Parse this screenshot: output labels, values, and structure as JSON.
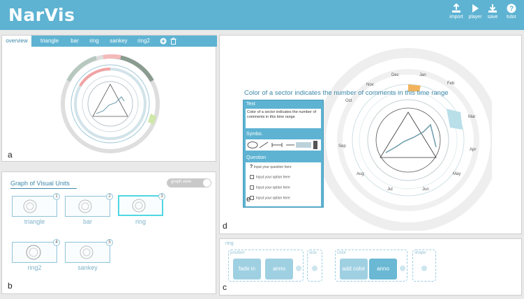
{
  "app": {
    "title": "NarVis"
  },
  "toolbar": {
    "import": "import",
    "player": "player",
    "save": "save",
    "tutor": "tutor"
  },
  "overview_tabs": [
    "overview",
    "triangle",
    "bar",
    "ring",
    "sankey",
    "ring2"
  ],
  "panel_labels": {
    "a": "a",
    "b": "b",
    "c": "c",
    "d": "d",
    "e": "e"
  },
  "graph": {
    "title": "Graph of Visual Units",
    "toggle": "graph view",
    "units": [
      {
        "num": "1",
        "label": "triangle"
      },
      {
        "num": "2",
        "label": "bar"
      },
      {
        "num": "3",
        "label": "ring"
      },
      {
        "num": "4",
        "label": "ring2"
      },
      {
        "num": "5",
        "label": "sankey"
      }
    ]
  },
  "canvas": {
    "sentence": "Color of a sector indicates the number of comments in this time range",
    "months": [
      "Dec",
      "Jan",
      "Feb",
      "Nov",
      "Oct",
      "Mar",
      "Sep",
      "Apr",
      "Aug",
      "May",
      "Jul",
      "Jun"
    ]
  },
  "popup": {
    "text_header": "Text",
    "text_body": "Color of a sector indicates the number of comments in this time range",
    "symbol_header": "Symbo.",
    "question_header": "Question",
    "question_placeholder": "Input your question here",
    "options": [
      "Input your option here",
      "Input your option here",
      "Input your option here"
    ]
  },
  "timeline": {
    "title": "ring",
    "groups": [
      {
        "label": "position",
        "blocks": [
          "fade in",
          "anno"
        ]
      },
      {
        "label": "size",
        "blocks": []
      },
      {
        "label": "color",
        "blocks": [
          "add color",
          "anno"
        ]
      },
      {
        "label": "shape",
        "blocks": []
      }
    ]
  }
}
